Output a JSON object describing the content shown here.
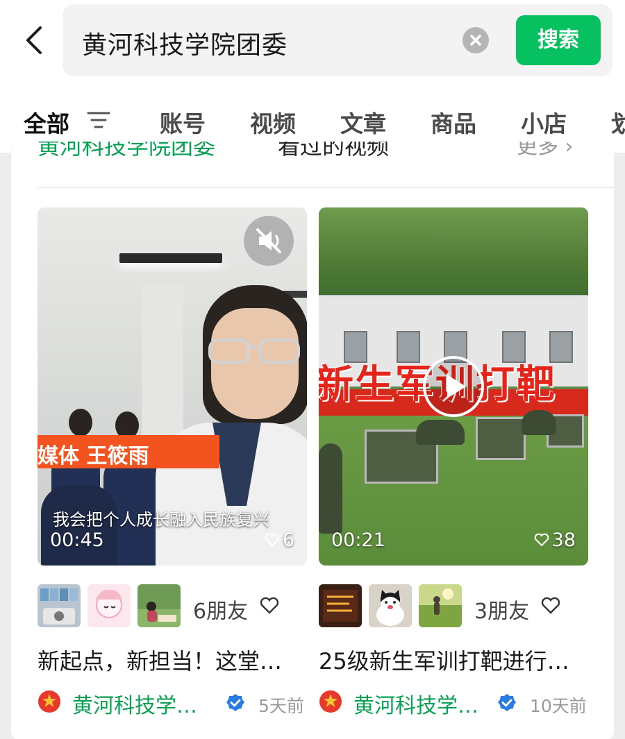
{
  "search": {
    "query": "黄河科技学院团委",
    "button_label": "搜索"
  },
  "tabs": [
    {
      "label": "全部",
      "active": true
    },
    {
      "label": "账号"
    },
    {
      "label": "视频"
    },
    {
      "label": "文章"
    },
    {
      "label": "商品"
    },
    {
      "label": "小店"
    },
    {
      "label": "划"
    }
  ],
  "section": {
    "title_green": "黄河科技学院团委",
    "title_dark": "看过的视频",
    "more_label": "更多 ›"
  },
  "videos": [
    {
      "duration": "00:45",
      "likes": "6",
      "banner_text": "媒体 王筱雨",
      "subtitle": "我会把个人成长融入民族复兴",
      "friends_label": "6朋友",
      "title": "新起点，新担当！这堂…",
      "author": "黄河科技学…",
      "time": "5天前",
      "muted": true
    },
    {
      "duration": "00:21",
      "likes": "38",
      "overlay_title": "新生军训打靶",
      "friends_label": "3朋友",
      "title": "25级新生军训打靶进行…",
      "author": "黄河科技学…",
      "time": "10天前"
    }
  ],
  "colors": {
    "brand_green": "#07c160",
    "link_green": "#07a052",
    "verified_blue": "#2a7be6",
    "banner_orange": "#f3531e"
  },
  "icons": [
    "back-arrow-icon",
    "clear-icon",
    "filter-icon",
    "mute-icon",
    "play-icon",
    "heart-icon",
    "verified-icon",
    "league-badge-icon"
  ]
}
